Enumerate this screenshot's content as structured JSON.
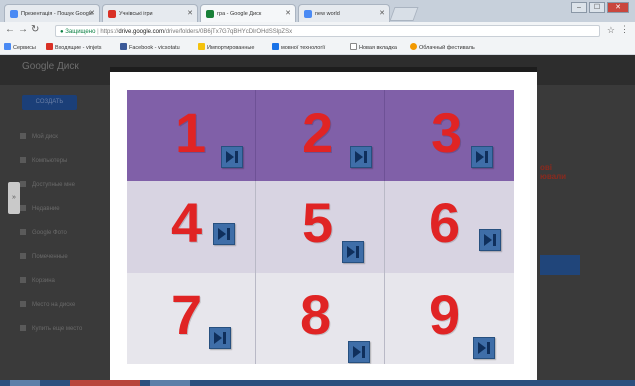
{
  "tabs": [
    {
      "label": "Презентація - Пошук Google",
      "fav_color": "#4a8af4",
      "active": false
    },
    {
      "label": "Учнівські ігри",
      "fav_color": "#d93025",
      "active": false
    },
    {
      "label": "гра - Google Диск",
      "fav_color": "#188038",
      "active": true
    },
    {
      "label": "new world",
      "fav_color": "#4a8af4",
      "active": false
    }
  ],
  "window_buttons": {
    "minimize": "‒",
    "maximize": "☐",
    "close": "✕"
  },
  "address": {
    "secure_label": "Защищено",
    "host": "drive.google.com",
    "path": "/drive/folders/0B6jTx7G7qBHYcDlrOHdSSlpZSx",
    "prefix": "https://"
  },
  "bookmarks": [
    {
      "label": "Сервисы",
      "color": "#4a8af4"
    },
    {
      "label": "Входящие - vinjets",
      "color": "#d93025"
    },
    {
      "label": "Facebook - vicsotatu",
      "color": "#3b5998"
    },
    {
      "label": "Импортированные",
      "color": "#f4c20d"
    },
    {
      "label": "мовної технології",
      "color": "#1a73e8"
    },
    {
      "label": "Новая вкладка",
      "color": "#ffffff"
    },
    {
      "label": "Облачный фестиваль",
      "color": "#f29900"
    }
  ],
  "drive": {
    "logo": "Google Диск",
    "create_button": "СОЗДАТЬ",
    "sidebar": [
      "Мой диск",
      "Компьютеры",
      "Доступные мне",
      "Недавние",
      "Google Фото",
      "Помеченные",
      "Корзина",
      "Место на диске",
      "Купить еще место"
    ],
    "right_text": "ові ювали"
  },
  "board": {
    "cells": [
      {
        "number": "1"
      },
      {
        "number": "2"
      },
      {
        "number": "3"
      },
      {
        "number": "4"
      },
      {
        "number": "5"
      },
      {
        "number": "6"
      },
      {
        "number": "7"
      },
      {
        "number": "8"
      },
      {
        "number": "9"
      }
    ]
  }
}
